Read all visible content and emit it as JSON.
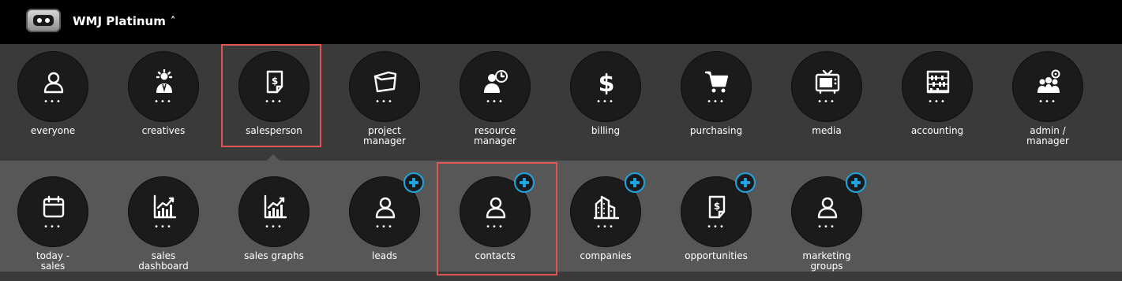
{
  "header": {
    "brand": "WMJ Platinum",
    "caret": "^"
  },
  "roles": [
    {
      "id": "everyone",
      "label": "everyone",
      "icon": "person-icon"
    },
    {
      "id": "creatives",
      "label": "creatives",
      "icon": "lightbulb-person-icon"
    },
    {
      "id": "salesperson",
      "label": "salesperson",
      "icon": "dollar-tag-icon",
      "selected": true
    },
    {
      "id": "project-manager",
      "label": "project manager",
      "icon": "folder-icon"
    },
    {
      "id": "resource-manager",
      "label": "resource manager",
      "icon": "person-clock-icon"
    },
    {
      "id": "billing",
      "label": "billing",
      "icon": "dollar-icon"
    },
    {
      "id": "purchasing",
      "label": "purchasing",
      "icon": "cart-icon"
    },
    {
      "id": "media",
      "label": "media",
      "icon": "tv-icon"
    },
    {
      "id": "accounting",
      "label": "accounting",
      "icon": "abacus-icon"
    },
    {
      "id": "admin-manager",
      "label": "admin / manager",
      "icon": "group-gear-icon"
    }
  ],
  "tools": [
    {
      "id": "today-sales",
      "label": "today - sales",
      "icon": "calendar-icon",
      "add": false
    },
    {
      "id": "sales-dashboard",
      "label": "sales dashboard",
      "icon": "bar-chart-icon",
      "add": false
    },
    {
      "id": "sales-graphs",
      "label": "sales graphs",
      "icon": "bar-chart-icon",
      "add": false
    },
    {
      "id": "leads",
      "label": "leads",
      "icon": "person-icon",
      "add": true
    },
    {
      "id": "contacts",
      "label": "contacts",
      "icon": "person-icon",
      "add": true,
      "selected": true
    },
    {
      "id": "companies",
      "label": "companies",
      "icon": "buildings-icon",
      "add": true
    },
    {
      "id": "opportunities",
      "label": "opportunities",
      "icon": "dollar-tag-icon",
      "add": true
    },
    {
      "id": "marketing-groups",
      "label": "marketing groups",
      "icon": "person-icon",
      "add": true
    }
  ],
  "colors": {
    "topbar": "#000000",
    "row1": "#3a3a3a",
    "row2": "#575757",
    "circle": "#1b1b1b",
    "add_accent": "#1ea4e0",
    "highlight": "#e05454"
  },
  "dots": "•••"
}
